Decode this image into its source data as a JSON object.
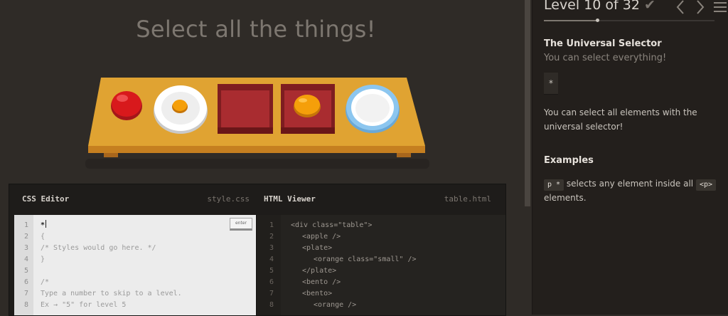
{
  "game": {
    "title": "Select all the things!"
  },
  "editor": {
    "css_title": "CSS Editor",
    "css_file": "style.css",
    "enter_label": "enter",
    "css_lines": [
      {
        "n": "1",
        "text": "*"
      },
      {
        "n": "2",
        "text": "{"
      },
      {
        "n": "3",
        "text": "/* Styles would go here. */"
      },
      {
        "n": "4",
        "text": "}"
      },
      {
        "n": "5",
        "text": ""
      },
      {
        "n": "6",
        "text": "/*"
      },
      {
        "n": "7",
        "text": "Type a number to skip to a level."
      },
      {
        "n": "8",
        "text": "Ex → \"5\" for level 5"
      }
    ],
    "html_title": "HTML Viewer",
    "html_file": "table.html",
    "html_lines": [
      {
        "n": "1",
        "text": "<div class=\"table\">"
      },
      {
        "n": "2",
        "text": "<apple />"
      },
      {
        "n": "3",
        "text": "<plate>"
      },
      {
        "n": "4",
        "text": "<orange class=\"small\" />"
      },
      {
        "n": "5",
        "text": "</plate>"
      },
      {
        "n": "6",
        "text": "<bento />"
      },
      {
        "n": "7",
        "text": "<bento>"
      },
      {
        "n": "8",
        "text": "<orange />"
      }
    ]
  },
  "sidebar": {
    "level_title": "Level 10 of 32",
    "level_current": 10,
    "level_total": 32,
    "heading": "The Universal Selector",
    "subheading": "You can select everything!",
    "selector": "*",
    "description": "You can select all elements with the universal selector!",
    "examples_title": "Examples",
    "example_code_1": "p *",
    "example_text_1": "selects any element inside all",
    "example_code_2": "<p>",
    "example_text_2": "elements."
  },
  "colors": {
    "background": "#2f2b27",
    "table": "#e0a332",
    "apple": "#d8191c",
    "orange": "#f59f0a",
    "bento": "#a92c30",
    "plate_rim": "#8cc6ef"
  }
}
